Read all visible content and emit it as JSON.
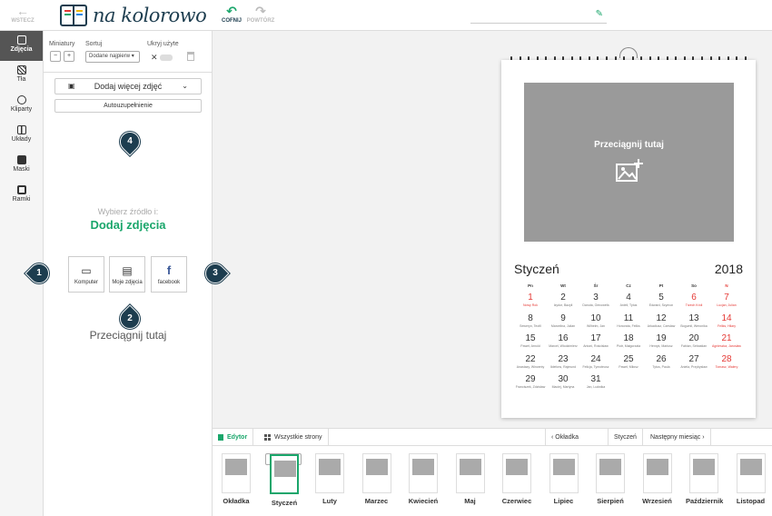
{
  "topbar": {
    "back_label": "WSTECZ",
    "logo_text": "na kolorowo",
    "undo_label": "COFNIJ",
    "redo_label": "POWTÓRZ",
    "title_value": ""
  },
  "nav": [
    {
      "label": "Zdjęcia",
      "icon": "photo-icon"
    },
    {
      "label": "Tła",
      "icon": "background-pattern-icon"
    },
    {
      "label": "Kliparty",
      "icon": "clipart-icon"
    },
    {
      "label": "Układy",
      "icon": "layout-icon"
    },
    {
      "label": "Maski",
      "icon": "mask-icon"
    },
    {
      "label": "Ramki",
      "icon": "frame-icon"
    }
  ],
  "panel": {
    "thumbs_label": "Miniatury",
    "sort_label": "Sortuj",
    "sort_value": "Dodane najpierw",
    "hide_used_label": "Ukryj użyte",
    "add_more_label": "Dodaj więcej zdjęć",
    "autofill_label": "Autouzupełnienie",
    "source_prompt": "Wybierz źródło i:",
    "add_photos": "Dodaj zdjęcia",
    "sources": [
      "Komputer",
      "Moje zdjęcia",
      "facebook"
    ],
    "drop_here": "Przeciągnij tutaj",
    "pins": [
      "1",
      "2",
      "3",
      "4"
    ]
  },
  "calendar": {
    "photo_prompt": "Przeciągnij tutaj",
    "month": "Styczeń",
    "year": "2018",
    "dow": [
      "Pn",
      "Wt",
      "Śr",
      "Cz",
      "Pt",
      "So",
      "N"
    ],
    "days": [
      {
        "d": "1",
        "n": "Nowy Rok",
        "red": true
      },
      {
        "d": "2",
        "n": "Izydor, Bazyli",
        "red": false
      },
      {
        "d": "3",
        "n": "Danuta, Genowefa",
        "red": false
      },
      {
        "d": "4",
        "n": "Anieli, Tytus",
        "red": false
      },
      {
        "d": "5",
        "n": "Edward, Szymon",
        "red": false
      },
      {
        "d": "6",
        "n": "Trzech Króli",
        "red": true
      },
      {
        "d": "7",
        "n": "Lucjan, Julian",
        "red": true
      },
      {
        "d": "8",
        "n": "Seweryn, Teofil",
        "red": false
      },
      {
        "d": "9",
        "n": "Marcelina, Julian",
        "red": false
      },
      {
        "d": "10",
        "n": "Wilhelm, Jan",
        "red": false
      },
      {
        "d": "11",
        "n": "Honorata, Feliks",
        "red": false
      },
      {
        "d": "12",
        "n": "Arkadiusz, Czesław",
        "red": false
      },
      {
        "d": "13",
        "n": "Bogumił, Weronika",
        "red": false
      },
      {
        "d": "14",
        "n": "Feliks, Hilary",
        "red": true
      },
      {
        "d": "15",
        "n": "Paweł, Arnold",
        "red": false
      },
      {
        "d": "16",
        "n": "Marcel, Włodzimierz",
        "red": false
      },
      {
        "d": "17",
        "n": "Antoni, Rościsław",
        "red": false
      },
      {
        "d": "18",
        "n": "Piotr, Małgorzata",
        "red": false
      },
      {
        "d": "19",
        "n": "Henryk, Mariusz",
        "red": false
      },
      {
        "d": "20",
        "n": "Fabian, Sebastian",
        "red": false
      },
      {
        "d": "21",
        "n": "Agnieszka, Jarosław",
        "red": true
      },
      {
        "d": "22",
        "n": "Anastazy, Wincenty",
        "red": false
      },
      {
        "d": "23",
        "n": "Ildefons, Rajmund",
        "red": false
      },
      {
        "d": "24",
        "n": "Felicja, Tymoteusz",
        "red": false
      },
      {
        "d": "25",
        "n": "Paweł, Miłosz",
        "red": false
      },
      {
        "d": "26",
        "n": "Tytus, Paula",
        "red": false
      },
      {
        "d": "27",
        "n": "Aniela, Przybysław",
        "red": false
      },
      {
        "d": "28",
        "n": "Tomasz, Walery",
        "red": true
      },
      {
        "d": "29",
        "n": "Franciszek, Zdzisław",
        "red": false
      },
      {
        "d": "30",
        "n": "Maciej, Martyna",
        "red": false
      },
      {
        "d": "31",
        "n": "Jan, Ludwika",
        "red": false
      }
    ]
  },
  "bottom": {
    "tab_editor": "Edytor",
    "tab_all_pages": "Wszystkie strony",
    "prev_label": "Okładka",
    "current_label": "Styczeń",
    "next_label": "Następny miesiąc",
    "pages": [
      "Okładka",
      "Styczeń",
      "Luty",
      "Marzec",
      "Kwiecień",
      "Maj",
      "Czerwiec",
      "Lipiec",
      "Sierpień",
      "Wrzesień",
      "Październik",
      "Listopad"
    ],
    "selected_index": 1
  },
  "colors": {
    "accent": "#1aa66b",
    "dark": "#1d3d4f",
    "holiday": "#e53935"
  }
}
